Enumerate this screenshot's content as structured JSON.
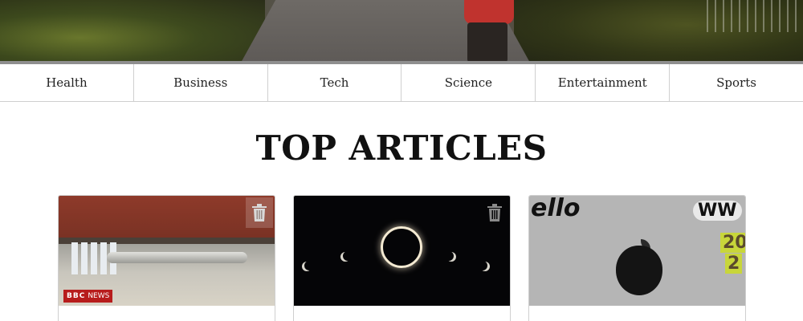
{
  "nav": {
    "items": [
      "Health",
      "Business",
      "Tech",
      "Science",
      "Entertainment",
      "Sports"
    ]
  },
  "section": {
    "title": "TOP ARTICLES"
  },
  "cards": [
    {
      "badge": {
        "brand": "BBC",
        "label": "NEWS"
      }
    },
    {},
    {
      "stickers": [
        "ello",
        "WW",
        "20",
        "2"
      ]
    }
  ],
  "colors": {
    "brand_red": "#b71c1c",
    "border": "#cfcfcf"
  },
  "icons": [
    "trash-icon"
  ]
}
